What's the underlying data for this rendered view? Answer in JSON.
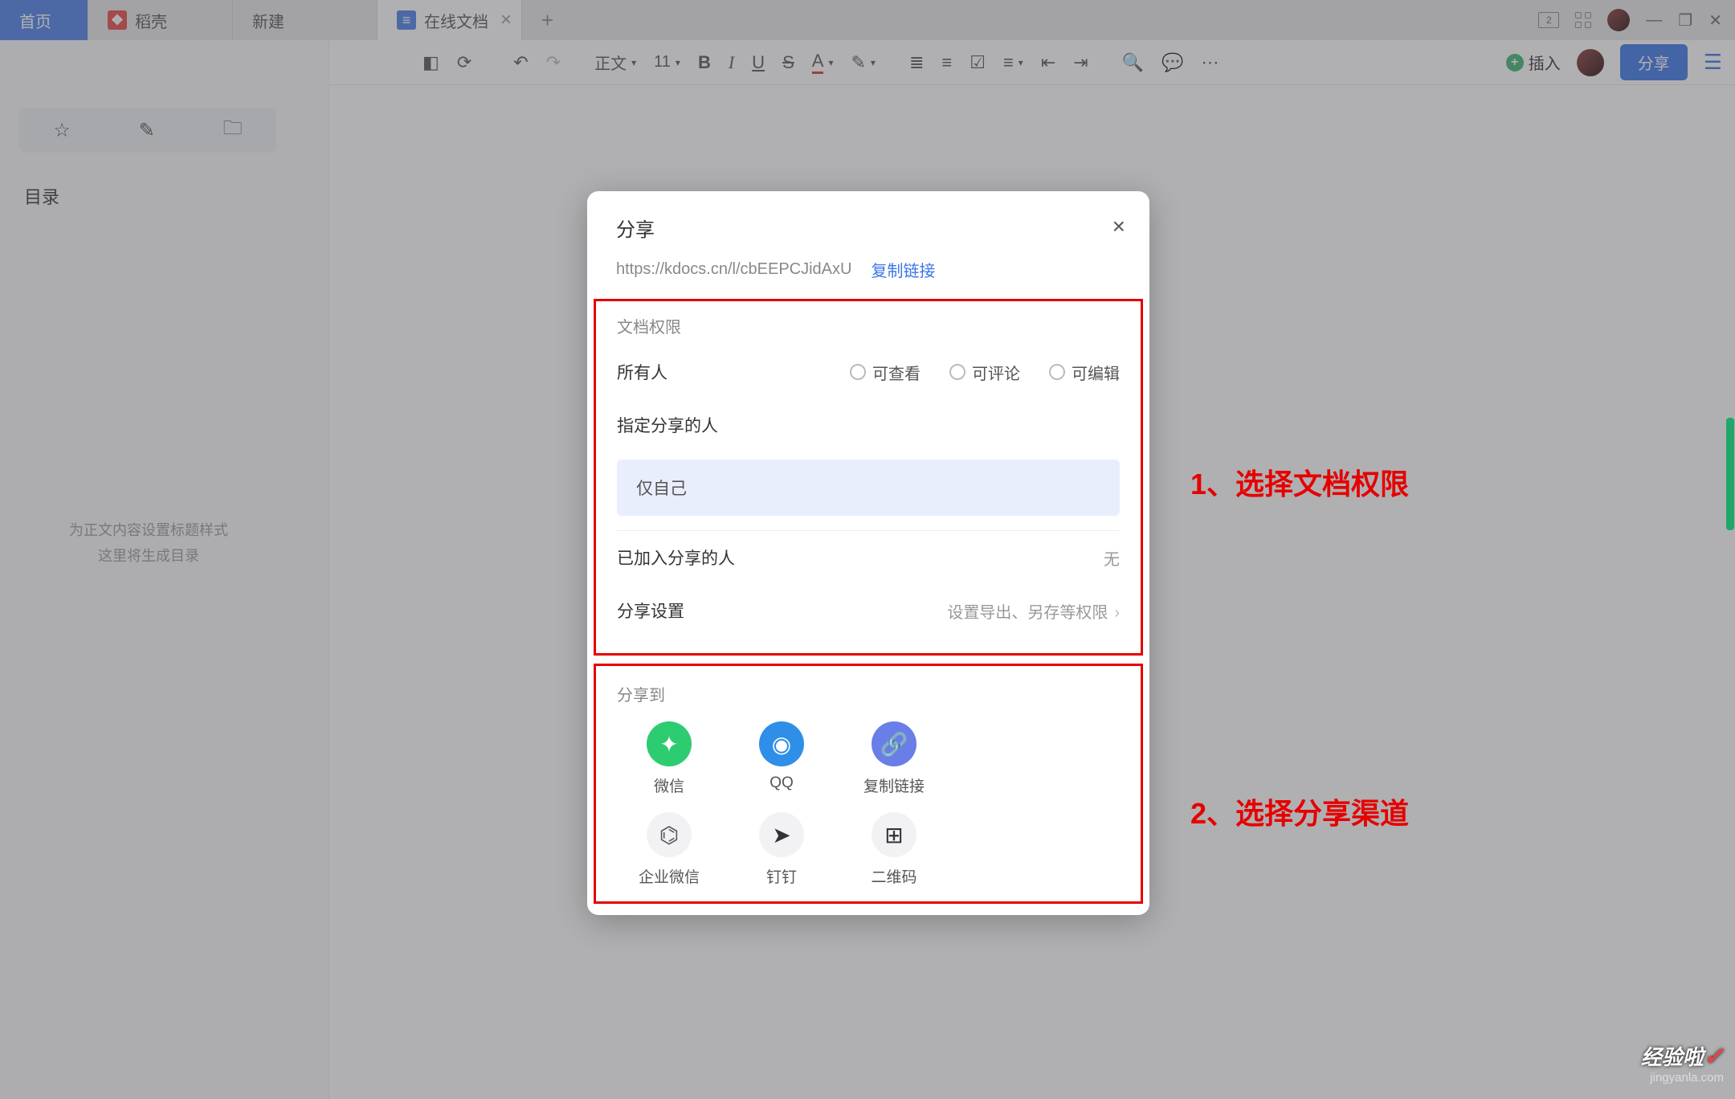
{
  "tabs": {
    "home": "首页",
    "docer": "稻壳",
    "newtab": "新建",
    "doc": "在线文档"
  },
  "winctrl": {
    "badge": "2"
  },
  "subheader": {
    "title": "在线文档",
    "style_label": "正文",
    "fontsize": "11",
    "insert": "插入",
    "share": "分享"
  },
  "toc": {
    "label": "目录",
    "hint_l1": "为正文内容设置标题样式",
    "hint_l2": "这里将生成目录"
  },
  "modal": {
    "title": "分享",
    "url": "https://kdocs.cn/l/cbEEPCJidAxU",
    "copy": "复制链接",
    "perm_header": "文档权限",
    "everyone": "所有人",
    "radio_view": "可查看",
    "radio_comment": "可评论",
    "radio_edit": "可编辑",
    "specified": "指定分享的人",
    "only_self": "仅自己",
    "joined": "已加入分享的人",
    "none": "无",
    "settings": "分享设置",
    "settings_hint": "设置导出、另存等权限",
    "share_to": "分享到",
    "wechat": "微信",
    "qq": "QQ",
    "copylink": "复制链接",
    "enterprise_wechat": "企业微信",
    "dingtalk": "钉钉",
    "qrcode": "二维码"
  },
  "annotations": {
    "a1": "1、选择文档权限",
    "a2": "2、选择分享渠道"
  },
  "watermark": {
    "brand": "经验啦",
    "site": "jingyanla.com"
  }
}
